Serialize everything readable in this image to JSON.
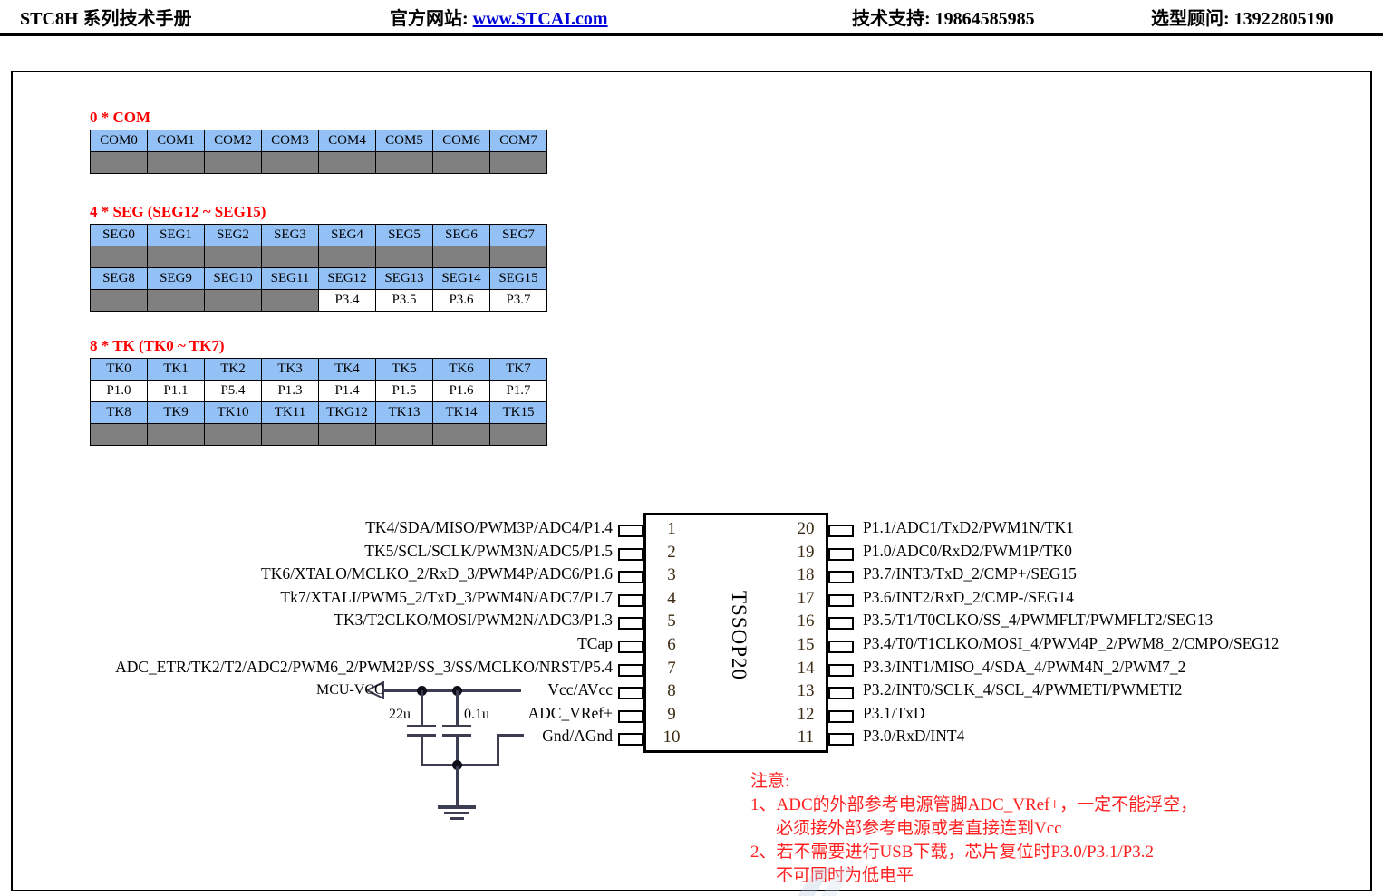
{
  "header": {
    "title": "STC8H 系列技术手册",
    "site_label": "官方网站: ",
    "site_url": "www.STCAI.com",
    "support": "技术支持: 19864585985",
    "sales": "选型顾问: 13922805190"
  },
  "tables": [
    {
      "id": "com",
      "title": "0 * COM",
      "rows": [
        {
          "style": "blue",
          "cells": [
            "COM0",
            "COM1",
            "COM2",
            "COM3",
            "COM4",
            "COM5",
            "COM6",
            "COM7"
          ]
        },
        {
          "style": "gray",
          "cells": [
            "",
            "",
            "",
            "",
            "",
            "",
            "",
            ""
          ]
        }
      ]
    },
    {
      "id": "seg",
      "title": "4 * SEG (SEG12 ~ SEG15)",
      "rows": [
        {
          "style": "blue",
          "cells": [
            "SEG0",
            "SEG1",
            "SEG2",
            "SEG3",
            "SEG4",
            "SEG5",
            "SEG6",
            "SEG7"
          ]
        },
        {
          "style": "gray",
          "cells": [
            "",
            "",
            "",
            "",
            "",
            "",
            "",
            ""
          ]
        },
        {
          "style": "blue",
          "cells": [
            "SEG8",
            "SEG9",
            "SEG10",
            "SEG11",
            "SEG12",
            "SEG13",
            "SEG14",
            "SEG15"
          ]
        },
        {
          "style": "mixed",
          "fills": [
            "gray",
            "gray",
            "gray",
            "gray",
            "white",
            "white",
            "white",
            "white"
          ],
          "cells": [
            "",
            "",
            "",
            "",
            "P3.4",
            "P3.5",
            "P3.6",
            "P3.7"
          ]
        }
      ]
    },
    {
      "id": "tk",
      "title": "8 * TK (TK0 ~ TK7)",
      "rows": [
        {
          "style": "blue",
          "cells": [
            "TK0",
            "TK1",
            "TK2",
            "TK3",
            "TK4",
            "TK5",
            "TK6",
            "TK7"
          ]
        },
        {
          "style": "white",
          "cells": [
            "P1.0",
            "P1.1",
            "P5.4",
            "P1.3",
            "P1.4",
            "P1.5",
            "P1.6",
            "P1.7"
          ]
        },
        {
          "style": "blue",
          "cells": [
            "TK8",
            "TK9",
            "TK10",
            "TK11",
            "TKG12",
            "TK13",
            "TK14",
            "TK15"
          ]
        },
        {
          "style": "gray",
          "cells": [
            "",
            "",
            "",
            "",
            "",
            "",
            "",
            ""
          ]
        }
      ]
    }
  ],
  "chip": {
    "package": "TSSOP20",
    "left_pins": [
      {
        "num": "1",
        "label": "TK4/SDA/MISO/PWM3P/ADC4/P1.4"
      },
      {
        "num": "2",
        "label": "TK5/SCL/SCLK/PWM3N/ADC5/P1.5"
      },
      {
        "num": "3",
        "label": "TK6/XTALO/MCLKO_2/RxD_3/PWM4P/ADC6/P1.6"
      },
      {
        "num": "4",
        "label": "Tk7/XTALI/PWM5_2/TxD_3/PWM4N/ADC7/P1.7"
      },
      {
        "num": "5",
        "label": "TK3/T2CLKO/MOSI/PWM2N/ADC3/P1.3"
      },
      {
        "num": "6",
        "label": "TCap"
      },
      {
        "num": "7",
        "label": "ADC_ETR/TK2/T2/ADC2/PWM6_2/PWM2P/SS_3/SS/MCLKO/NRST/P5.4"
      },
      {
        "num": "8",
        "label": "Vcc/AVcc"
      },
      {
        "num": "9",
        "label": "ADC_VRef+"
      },
      {
        "num": "10",
        "label": "Gnd/AGnd"
      }
    ],
    "right_pins": [
      {
        "num": "20",
        "label": "P1.1/ADC1/TxD2/PWM1N/TK1"
      },
      {
        "num": "19",
        "label": "P1.0/ADC0/RxD2/PWM1P/TK0"
      },
      {
        "num": "18",
        "label": "P3.7/INT3/TxD_2/CMP+/SEG15"
      },
      {
        "num": "17",
        "label": "P3.6/INT2/RxD_2/CMP-/SEG14"
      },
      {
        "num": "16",
        "label": "P3.5/T1/T0CLKO/SS_4/PWMFLT/PWMFLT2/SEG13"
      },
      {
        "num": "15",
        "label": "P3.4/T0/T1CLKO/MOSI_4/PWM4P_2/PWM8_2/CMPO/SEG12"
      },
      {
        "num": "14",
        "label": "P3.3/INT1/MISO_4/SDA_4/PWM4N_2/PWM7_2"
      },
      {
        "num": "13",
        "label": "P3.2/INT0/SCLK_4/SCL_4/PWMETI/PWMETI2"
      },
      {
        "num": "12",
        "label": "P3.1/TxD"
      },
      {
        "num": "11",
        "label": "P3.0/RxD/INT4"
      }
    ]
  },
  "circuit": {
    "mcu_vcc_label": "MCU-VCC",
    "cap1_label": "22u",
    "cap2_label": "0.1u"
  },
  "note": {
    "heading": "注意:",
    "line1": "1、ADC的外部参考电源管脚ADC_VRef+，一定不能浮空，",
    "line1b": "必须接外部参考电源或者直接连到Vcc",
    "line2": "2、若不需要进行USB下载，芯片复位时P3.0/P3.1/P3.2",
    "line2b": "不可同时为低电平"
  },
  "colors": {
    "table_header_blue": "#93c0f5",
    "table_gray": "#808080",
    "accent_red": "#ff0000",
    "link_blue": "#0000d8",
    "note_red": "#ff2020"
  }
}
